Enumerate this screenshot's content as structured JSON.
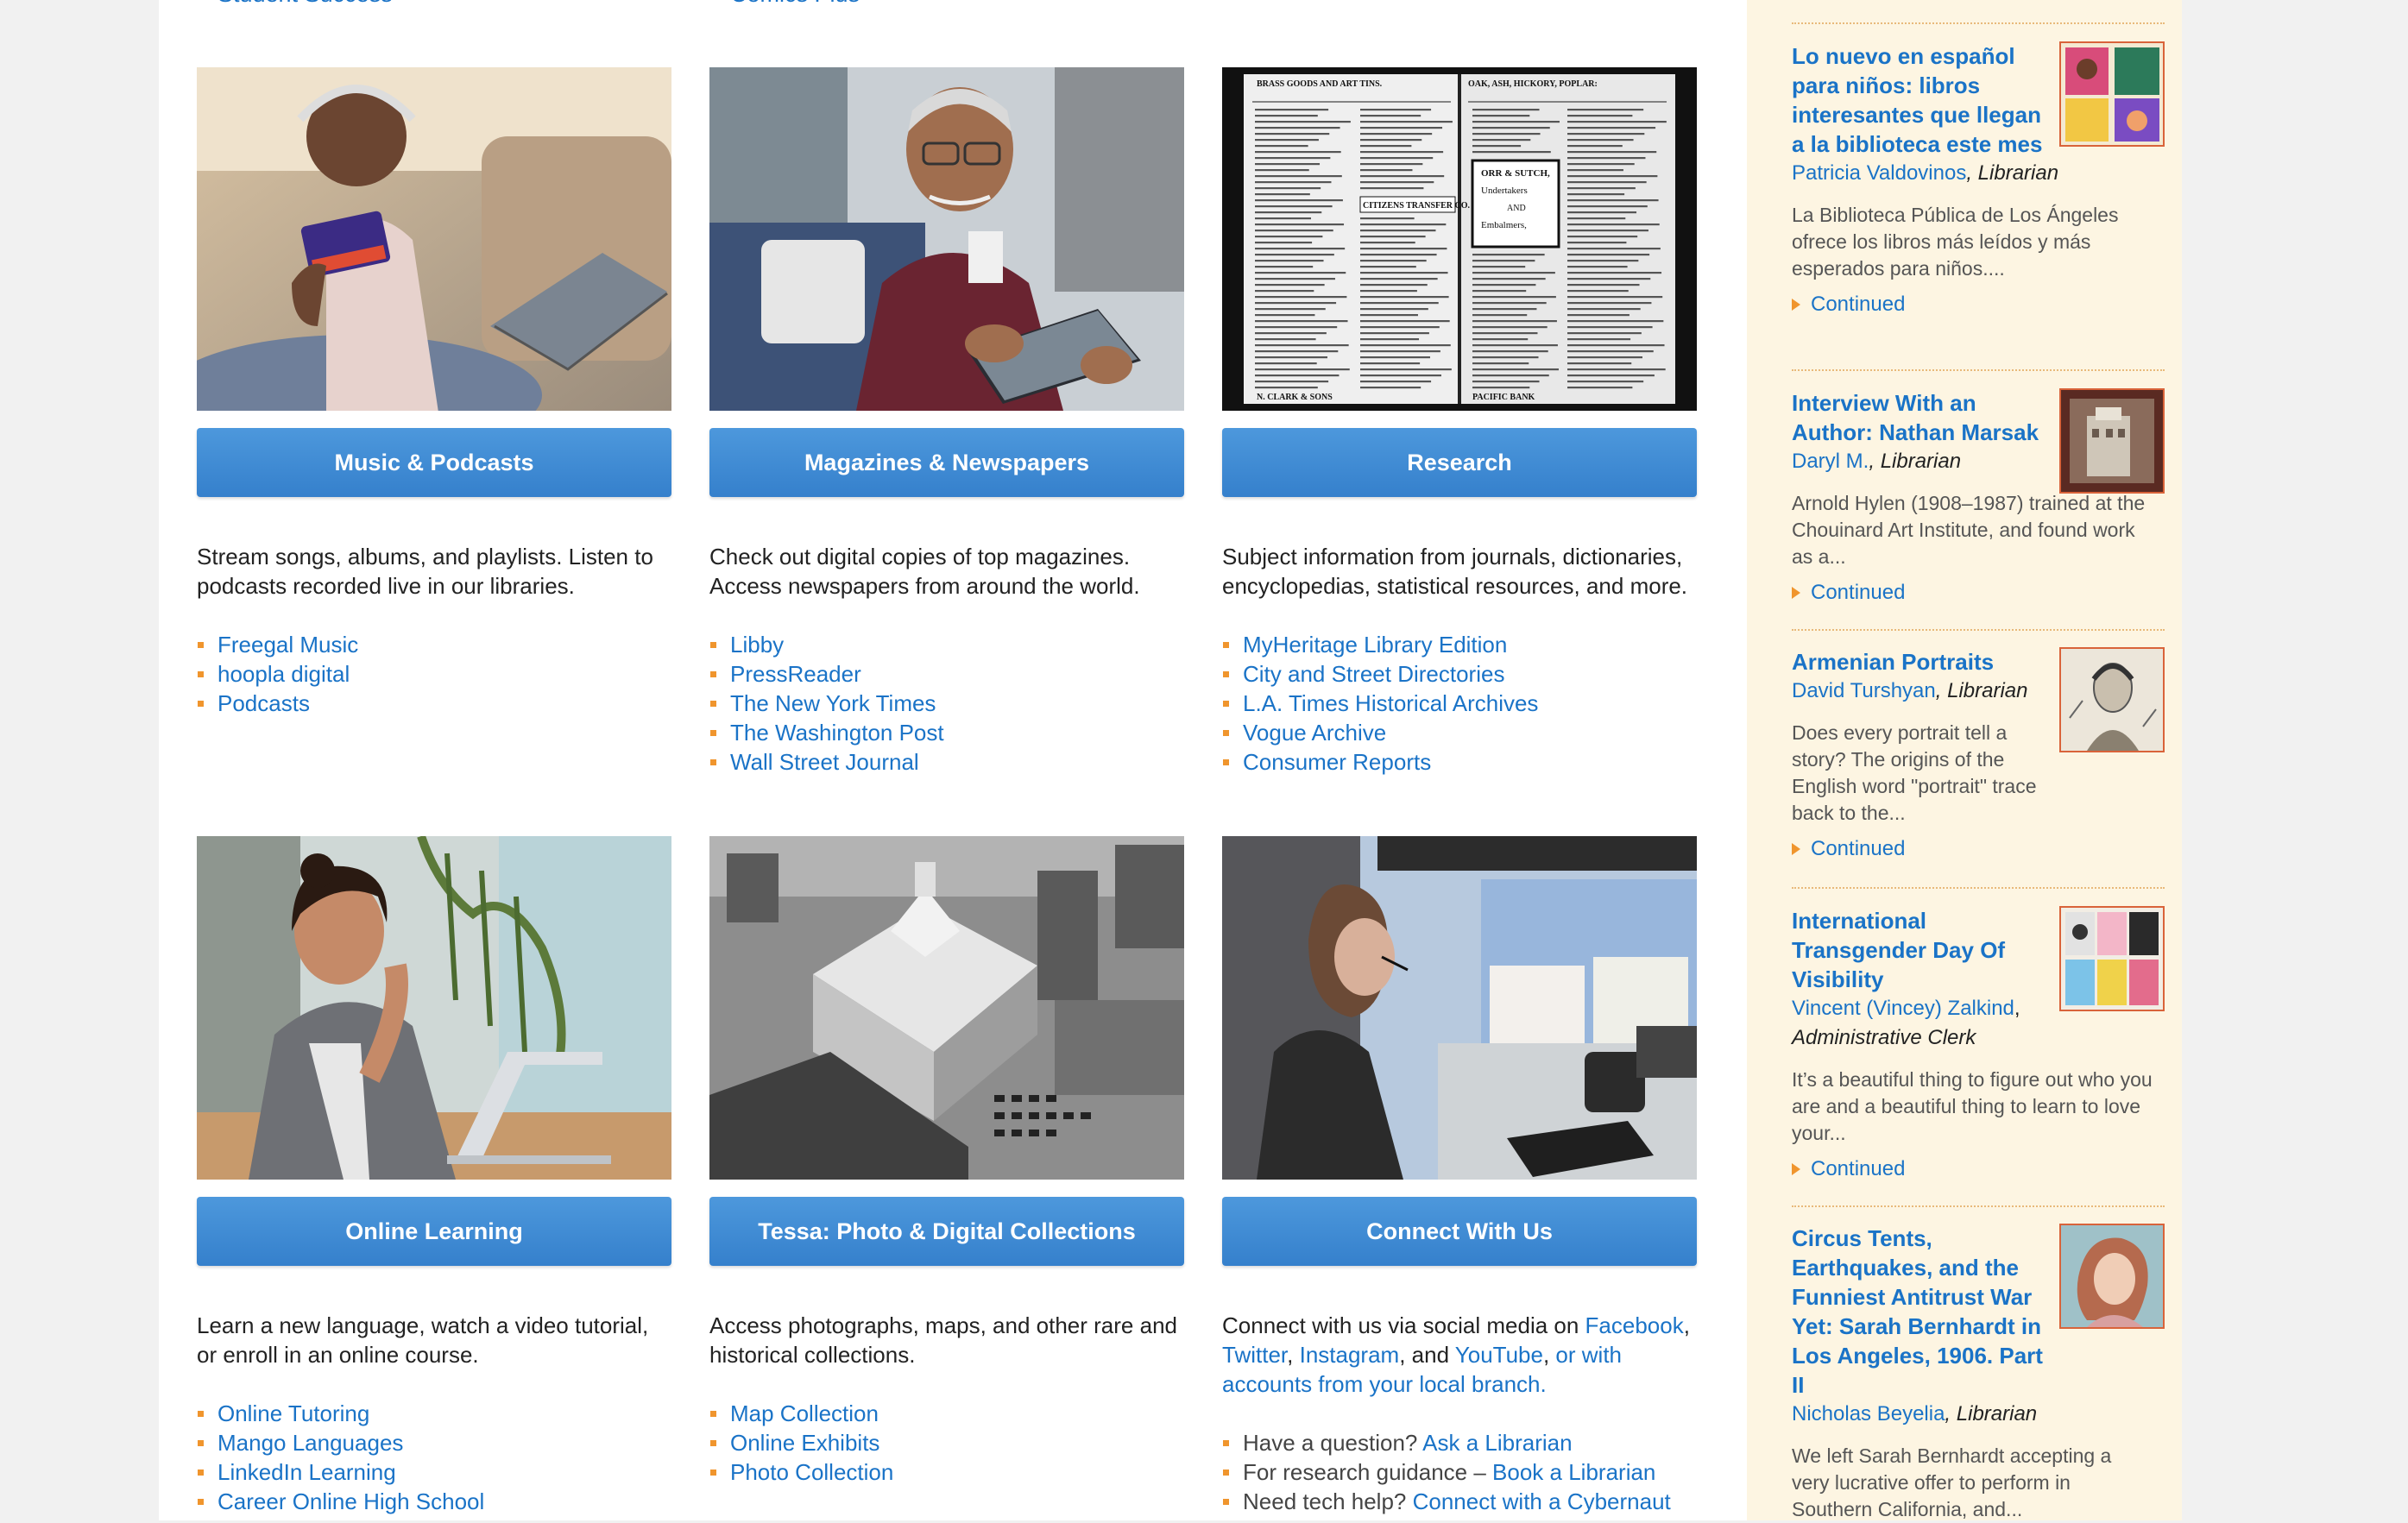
{
  "top_cut": {
    "left": "Student Success",
    "right": "Comics Plus"
  },
  "cards": [
    {
      "button": "Music & Podcasts",
      "description": "Stream songs, albums, and playlists. Listen to podcasts recorded live in our libraries.",
      "links": [
        "Freegal Music",
        "hoopla digital",
        "Podcasts"
      ]
    },
    {
      "button": "Magazines & Newspapers",
      "description": "Check out digital copies of top magazines. Access newspapers from around the world.",
      "links": [
        "Libby",
        "PressReader",
        "The New York Times",
        "The Washington Post",
        "Wall Street Journal"
      ]
    },
    {
      "button": "Research",
      "description": "Subject information from journals, dictionaries, encyclopedias, statistical resources, and more.",
      "links": [
        "MyHeritage Library Edition",
        "City and Street Directories",
        "L.A. Times Historical Archives",
        "Vogue Archive",
        "Consumer Reports"
      ]
    },
    {
      "button": "Online Learning",
      "description": "Learn a new language, watch a video tutorial, or enroll in an online course.",
      "links": [
        "Online Tutoring",
        "Mango Languages",
        "LinkedIn Learning",
        "Career Online High School"
      ]
    },
    {
      "button": "Tessa: Photo & Digital Collections",
      "description": "Access photographs, maps, and other rare and historical collections.",
      "links": [
        "Map Collection",
        "Online Exhibits",
        "Photo Collection"
      ]
    },
    {
      "button": "Connect With Us",
      "desc_parts": {
        "p1": "Connect with us via social media on ",
        "facebook": "Facebook",
        "comma1": ",",
        "twitter": "Twitter",
        "comma2": ", ",
        "instagram": "Instagram",
        "and": ", and ",
        "youtube": "YouTube",
        "comma3": ", ",
        "branch": "or with accounts from your local branch."
      },
      "help": [
        {
          "plain": "Have a question? ",
          "link": "Ask a Librarian"
        },
        {
          "plain": "For research guidance – ",
          "link": "Book a Librarian"
        },
        {
          "plain": "Need tech help? ",
          "link": "Connect with a Cybernaut"
        }
      ]
    }
  ],
  "research_image": {
    "header_left": "BRASS GOODS AND ART TINS.",
    "header_right": "OAK, ASH, HICKORY, POPLAR:",
    "box_lines": [
      "ORR & SUTCH,",
      "Undertakers",
      "AND",
      "Embalmers,"
    ],
    "company": "CITIZENS TRANSFER CO.",
    "footer_left": "N. CLARK & SONS",
    "footer_right": "PACIFIC BANK"
  },
  "sidebar": {
    "continued_label": "Continued",
    "items": [
      {
        "title": "Lo nuevo en español para niños: libros interesantes que llegan a la biblioteca este mes",
        "author": "Patricia Valdovinos",
        "role": "Librarian",
        "excerpt": "La Biblioteca Pública de Los Ángeles ofrece los libros más leídos y más esperados para niños...."
      },
      {
        "title": "Interview With an Author: Nathan Marsak",
        "author": "Daryl M.",
        "role": "Librarian",
        "excerpt": "Arnold Hylen (1908–1987) trained at the Chouinard Art Institute, and found work as a..."
      },
      {
        "title": "Armenian Portraits",
        "author": "David Turshyan",
        "role": "Librarian",
        "excerpt": "Does every portrait tell a story? The origins of the English word \"portrait\" trace back to the..."
      },
      {
        "title": "International Transgender Day Of Visibility",
        "author": "Vincent (Vincey) Zalkind",
        "role": "Administrative Clerk",
        "excerpt": "It’s a beautiful thing to figure out who you are and a beautiful thing to learn to love your..."
      },
      {
        "title": "Circus Tents, Earthquakes, and the Funniest Antitrust War Yet: Sarah Bernhardt in Los Angeles, 1906. Part II",
        "author": "Nicholas Beyelia",
        "role": "Librarian",
        "excerpt": "We left Sarah Bernhardt accepting a very lucrative offer to perform in Southern California, and..."
      }
    ]
  }
}
